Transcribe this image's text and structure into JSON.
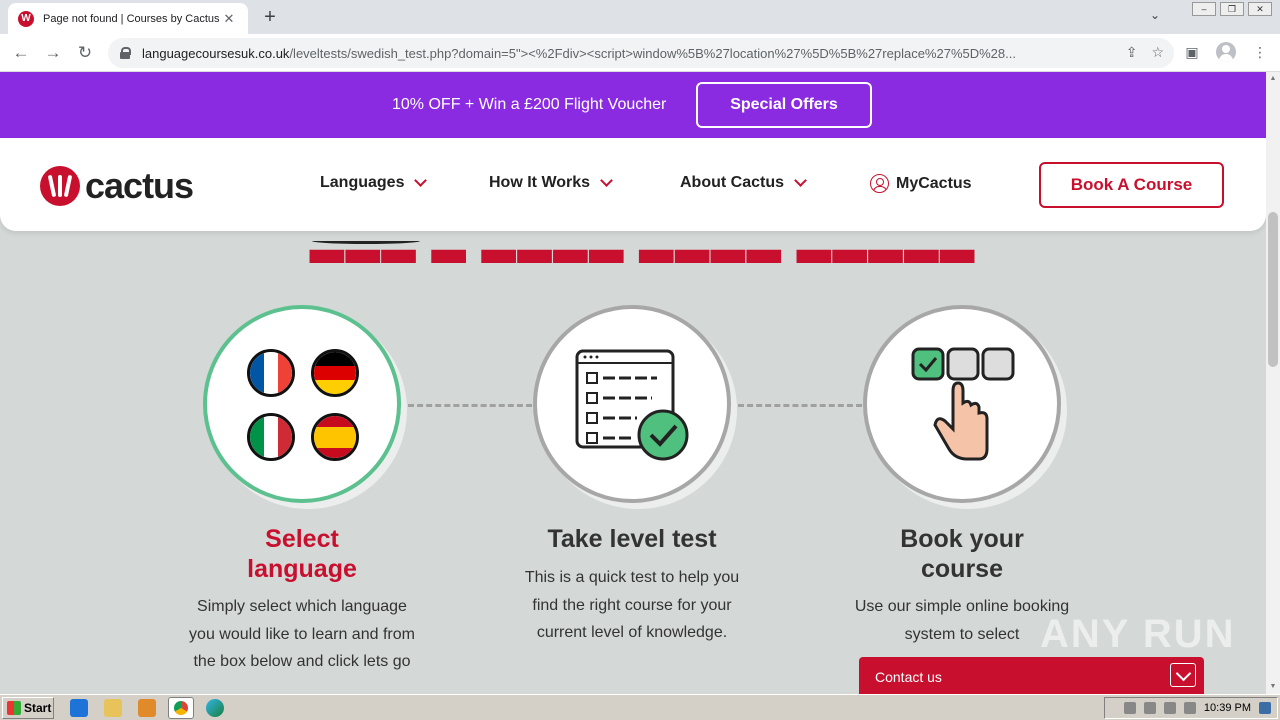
{
  "browser": {
    "tab_title": "Page not found | Courses by Cactus",
    "tab_favicon": "cactus-logo",
    "url_domain": "languagecoursesuk.co.uk",
    "url_path": "/leveltests/swedish_test.php?domain=5\"><%2Fdiv><script>window%5B%27location%27%5D%5B%27replace%27%5D%28..."
  },
  "promo": {
    "text": "10% OFF + Win a £200 Flight Voucher",
    "button": "Special Offers",
    "color": "#8a2be2"
  },
  "header": {
    "logo_text": "cactus",
    "nav": [
      {
        "label": "Languages"
      },
      {
        "label": "How It Works"
      },
      {
        "label": "About Cactus"
      }
    ],
    "account": "MyCactus",
    "cta": "Book A Course",
    "brand_color": "#c8102e"
  },
  "steps": [
    {
      "title": "Select language",
      "desc": "Simply select which language you would like to learn and from the box below and click lets go",
      "icon": "flags-icon"
    },
    {
      "title": "Take level test",
      "desc": "This is a quick test to help you find the right course for your current level of knowledge.",
      "icon": "checklist-icon"
    },
    {
      "title": "Book your course",
      "desc": "Use our simple online booking system to select",
      "icon": "hand-select-icon"
    }
  ],
  "contact": {
    "label": "Contact us"
  },
  "watermark": "ANY RUN",
  "taskbar": {
    "start": "Start",
    "clock": "10:39 PM"
  }
}
